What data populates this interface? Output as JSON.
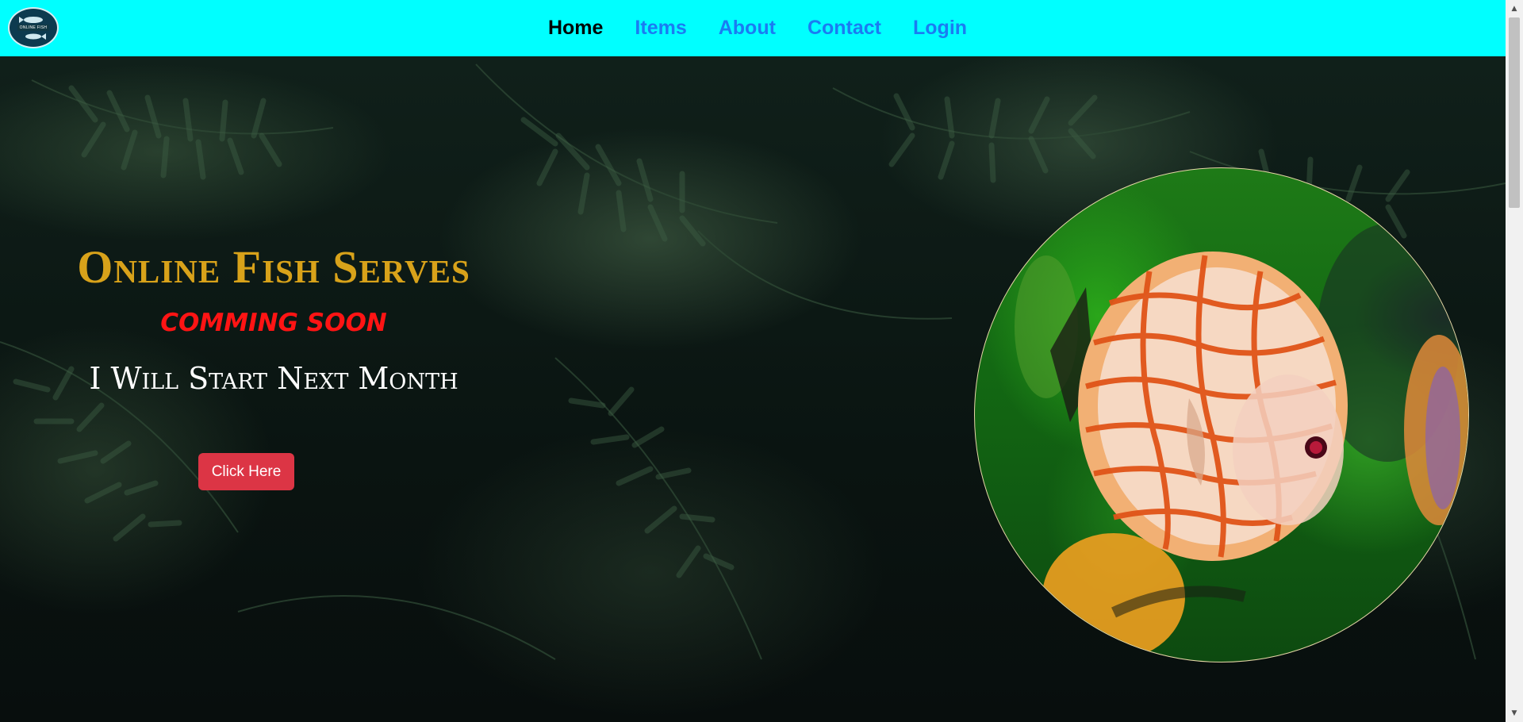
{
  "nav": {
    "logo_text": "ONLINE FISH",
    "items": [
      {
        "label": "Home",
        "active": true
      },
      {
        "label": "Items",
        "active": false
      },
      {
        "label": "About",
        "active": false
      },
      {
        "label": "Contact",
        "active": false
      },
      {
        "label": "Login",
        "active": false
      }
    ],
    "background": "#00ffff",
    "link_color": "#1a7cf2"
  },
  "hero": {
    "title": "Online Fish Serves",
    "subtitle": "COMMING SOON",
    "tagline": "I Will Start Next Month",
    "cta_label": "Click Here",
    "title_color": "#d8a21a",
    "subtitle_color": "#ff1414",
    "cta_color": "#dc3545"
  },
  "scrollbar": {
    "up_icon": "chevron-up-icon",
    "down_icon": "chevron-down-icon"
  }
}
